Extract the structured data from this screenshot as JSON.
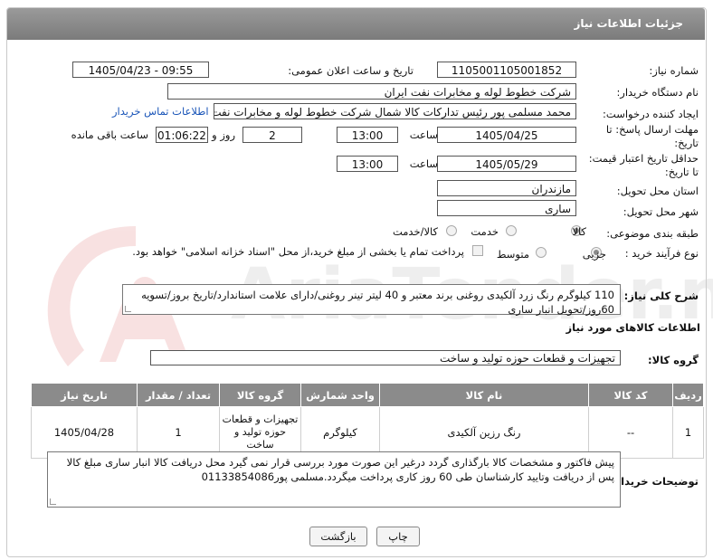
{
  "header": {
    "title": "جزئیات اطلاعات نیاز"
  },
  "form": {
    "need_number_label": "شماره نیاز:",
    "need_number": "1105001105001852",
    "announce_label": "تاریخ و ساعت اعلان عمومی:",
    "announce_value": "1405/04/23 - 09:55",
    "buyer_org_label": "نام دستگاه خریدار:",
    "buyer_org": "شرکت خطوط لوله و مخابرات نفت ایران",
    "creator_label": "ایجاد کننده درخواست:",
    "creator": "محمد مسلمی پور رئیس تدارکات کالا شمال شرکت خطوط لوله و مخابرات نفت ا",
    "contact_link": "اطلاعات تماس خریدار",
    "deadline_label_1": "مهلت ارسال پاسخ: تا",
    "deadline_label_2": "تاریخ:",
    "deadline_date": "1405/04/25",
    "time_label": "ساعت",
    "deadline_time": "13:00",
    "days_value": "2",
    "days_label": "روز و",
    "remaining_time": "01:06:22",
    "remaining_label": "ساعت باقی مانده",
    "validity_label_1": "حداقل تاریخ اعتبار قیمت:",
    "validity_label_2": "تا تاریخ:",
    "validity_date": "1405/05/29",
    "validity_time": "13:00",
    "province_label": "استان محل تحویل:",
    "province": "مازندران",
    "city_label": "شهر محل تحویل:",
    "city": "ساری",
    "category_label": "طبقه بندی موضوعی:",
    "category_options": [
      "کالا",
      "خدمت",
      "کالا/خدمت"
    ],
    "category_selected": "کالا",
    "purchase_type_label": "نوع فرآیند خرید :",
    "purchase_options": [
      "جزیی",
      "متوسط"
    ],
    "purchase_selected": "جزیی",
    "payment_text": "پرداخت تمام یا بخشی از مبلغ خرید،از محل \"اسناد خزانه اسلامی\" خواهد بود."
  },
  "description": {
    "label": "شرح کلی نیاز:",
    "text": "110 کیلوگرم رنگ زرد آلکیدی روغنی برند معتبر و 40 لیتر تینر روغنی/دارای علامت استاندارد/تاریخ بروز/تسویه 60روز/تحویل انبار ساری"
  },
  "goods_info": {
    "section_title": "اطلاعات کالاهای مورد نیاز",
    "group_label": "گروه کالا:",
    "group_value": "تجهیزات و قطعات حوزه تولید و ساخت"
  },
  "table": {
    "headers": [
      "ردیف",
      "کد کالا",
      "نام کالا",
      "واحد شمارش",
      "گروه کالا",
      "تعداد / مقدار",
      "تاریخ نیاز"
    ],
    "rows": [
      [
        "1",
        "--",
        "رنگ رزین آلکیدی",
        "کیلوگرم",
        "تجهیزات و قطعات حوزه تولید و ساخت",
        "1",
        "1405/04/28"
      ]
    ]
  },
  "buyer_notes": {
    "label": "توضیحات خریدار:",
    "text": "پیش فاکتور و مشخصات کالا بارگذاری گردد درغیر این صورت مورد بررسی قرار نمی گیرد محل دریافت کالا انبار ساری مبلغ کالا پس از دریافت وتایید کارشناسان طی 60 روز کاری پرداخت میگردد.مسلمی پور01133854086"
  },
  "buttons": {
    "print": "چاپ",
    "back": "بازگشت"
  },
  "watermark": "AriaTender.net"
}
